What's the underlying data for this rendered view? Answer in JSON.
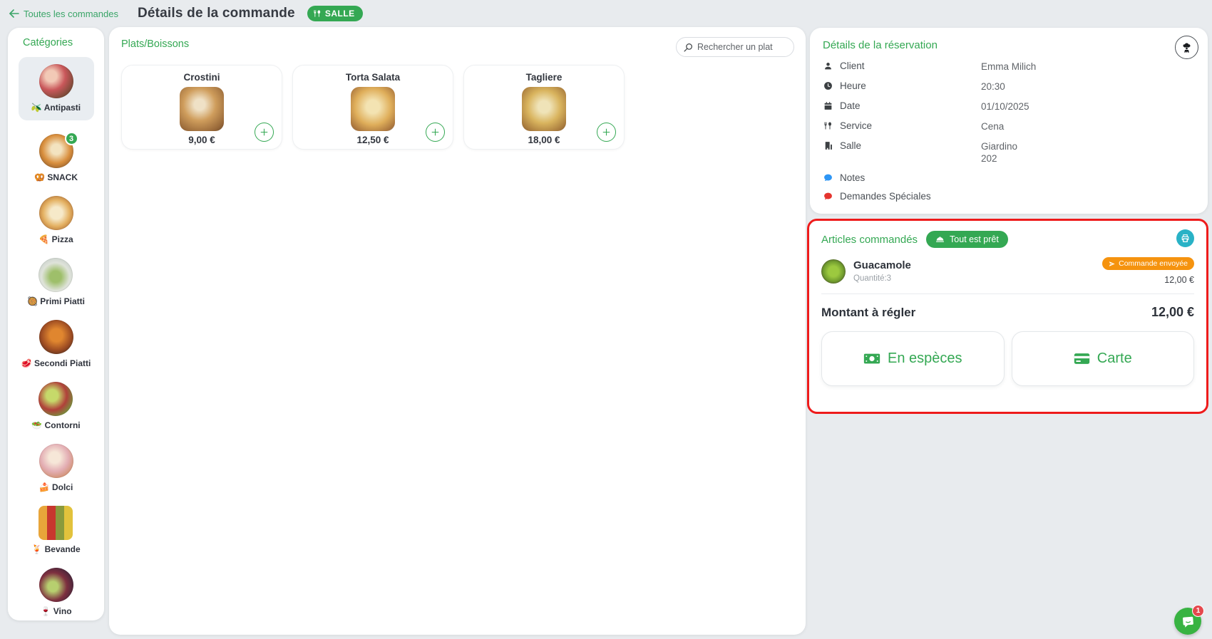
{
  "topbar": {
    "back_label": "Toutes les commandes",
    "title": "Détails de la commande",
    "badge": "SALLE"
  },
  "sidebar": {
    "heading": "Catégories",
    "items": [
      {
        "emoji": "🫒",
        "name": "Antipasti",
        "selected": true
      },
      {
        "emoji": "🥨",
        "name": "SNACK",
        "badge": "3"
      },
      {
        "emoji": "🍕",
        "name": "Pizza"
      },
      {
        "emoji": "🥘",
        "name": "Primi Piatti"
      },
      {
        "emoji": "🥩",
        "name": "Secondi Piatti"
      },
      {
        "emoji": "🥗",
        "name": "Contorni"
      },
      {
        "emoji": "🍰",
        "name": "Dolci"
      },
      {
        "emoji": "🍹",
        "name": "Bevande"
      },
      {
        "emoji": "🍷",
        "name": "Vino"
      }
    ]
  },
  "menu": {
    "heading": "Plats/Boissons",
    "search_placeholder": "Rechercher un plat",
    "products": [
      {
        "name": "Crostini",
        "price": "9,00 €"
      },
      {
        "name": "Torta Salata",
        "price": "12,50 €"
      },
      {
        "name": "Tagliere",
        "price": "18,00 €"
      }
    ]
  },
  "reservation": {
    "heading": "Détails de la réservation",
    "rows": [
      {
        "label": "Client",
        "value": "Emma Milich"
      },
      {
        "label": "Heure",
        "value": "20:30"
      },
      {
        "label": "Date",
        "value": "01/10/2025"
      },
      {
        "label": "Service",
        "value": "Cena"
      },
      {
        "label": "Salle",
        "value": "Giardino\n202"
      },
      {
        "label": "Notes",
        "value": ""
      },
      {
        "label": "Demandes Spéciales",
        "value": ""
      }
    ]
  },
  "order": {
    "heading": "Articles commandés",
    "ready_badge": "Tout est prêt",
    "items": [
      {
        "name": "Guacamole",
        "quantity": "Quantité:3",
        "status": "Commande envoyée",
        "price": "12,00 €"
      }
    ],
    "total_label": "Montant à régler",
    "total_value": "12,00 €",
    "pay_cash_label": "En espèces",
    "pay_card_label": "Carte"
  },
  "chat": {
    "unread": "1"
  },
  "colors": {
    "accent_green": "#34a853",
    "link_green": "#3aa568",
    "badge_orange": "#f5930f",
    "printer_teal": "#29b2c6",
    "alert_red_border": "#ee1b1b",
    "notification_red": "#e5484d",
    "chat_green": "#38b342",
    "page_background": "#e8ebee"
  }
}
